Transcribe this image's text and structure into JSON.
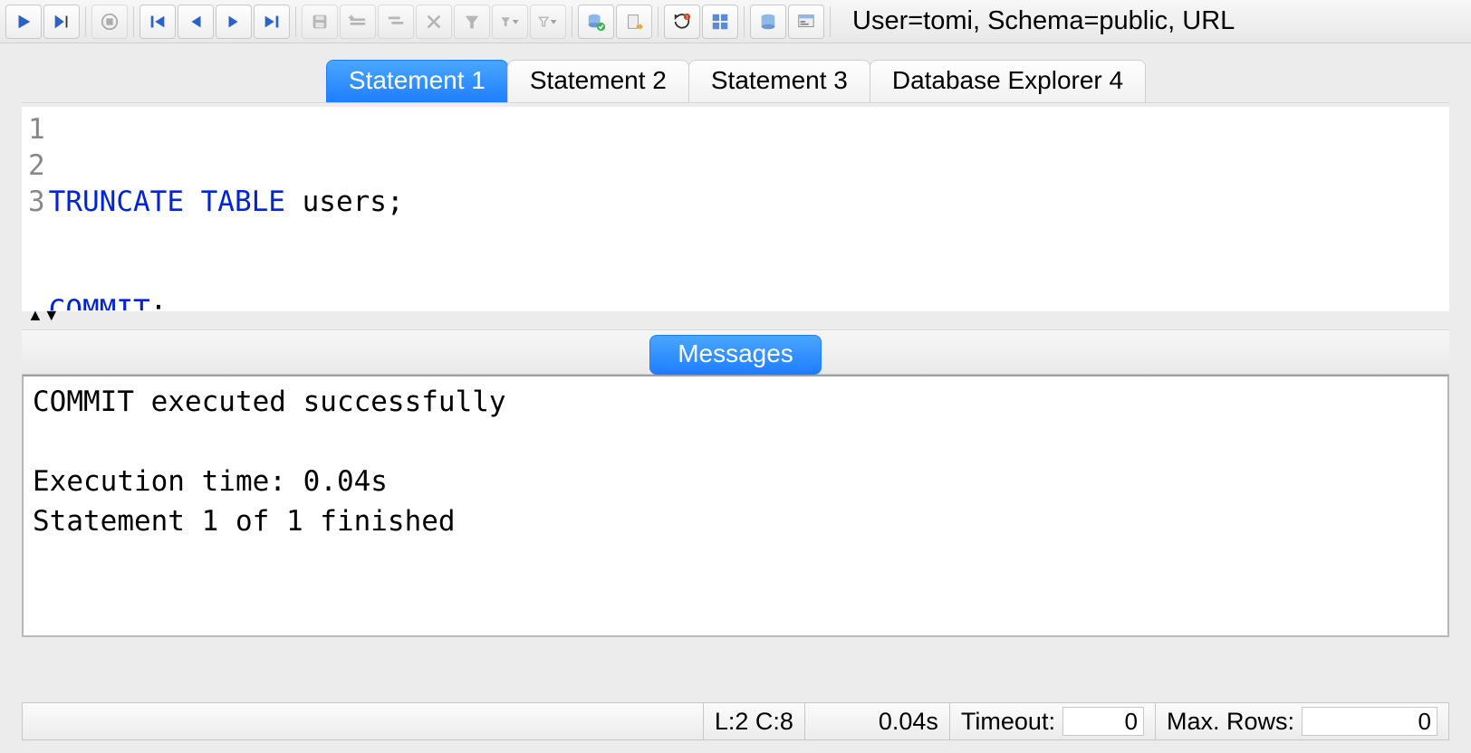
{
  "toolbar": {
    "connection_status": "User=tomi, Schema=public, URL"
  },
  "tabs": [
    {
      "label": "Statement 1",
      "active": true
    },
    {
      "label": "Statement 2",
      "active": false
    },
    {
      "label": "Statement 3",
      "active": false
    },
    {
      "label": "Database Explorer 4",
      "active": false
    }
  ],
  "editor": {
    "lines": [
      {
        "n": "1",
        "kw": "TRUNCATE TABLE",
        "rest": " users;"
      },
      {
        "n": "2",
        "kw": "COMMIT",
        "rest": ";"
      },
      {
        "n": "3",
        "kw": "",
        "rest": ""
      }
    ]
  },
  "messages": {
    "tab_label": "Messages",
    "text": "COMMIT executed successfully\n\nExecution time: 0.04s\nStatement 1 of 1 finished"
  },
  "statusbar": {
    "cursor": "L:2 C:8",
    "exec_time": "0.04s",
    "timeout_label": "Timeout:",
    "timeout_value": "0",
    "maxrows_label": "Max. Rows:",
    "maxrows_value": "0"
  }
}
